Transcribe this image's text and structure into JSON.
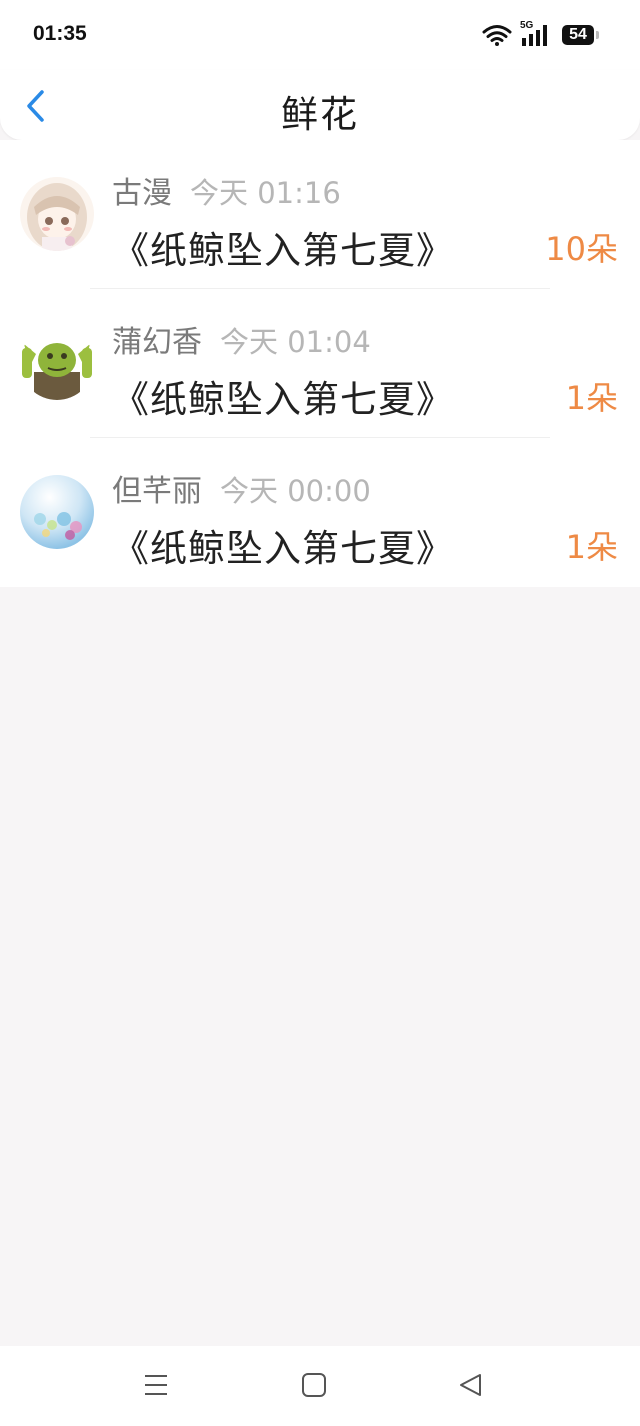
{
  "status_bar": {
    "time": "01:35",
    "network": "5G",
    "battery": "54"
  },
  "header": {
    "title": "鲜花"
  },
  "items": [
    {
      "name": "古漫",
      "time": "今天 01:16",
      "book": "《纸鲸坠入第七夏》",
      "count": "10朵"
    },
    {
      "name": "蒲幻香",
      "time": "今天 01:04",
      "book": "《纸鲸坠入第七夏》",
      "count": "1朵"
    },
    {
      "name": "但芊丽",
      "time": "今天 00:00",
      "book": "《纸鲸坠入第七夏》",
      "count": "1朵"
    }
  ],
  "colors": {
    "accent": "#2a8ae6",
    "count": "#ee8a45",
    "background": "#f7f5f6"
  },
  "icons": [
    "back-chevron-icon",
    "wifi-icon",
    "signal-icon",
    "battery-icon",
    "menu-icon",
    "home-icon",
    "back-triangle-icon"
  ]
}
